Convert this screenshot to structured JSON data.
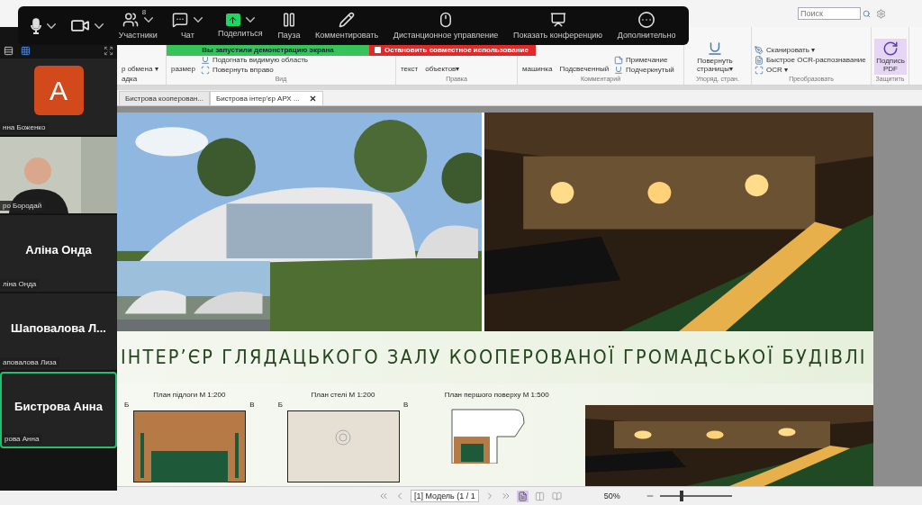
{
  "app_window": {
    "search": {
      "placeholder": "Поиск"
    }
  },
  "ribbon": {
    "groups": [
      {
        "items": [
          {
            "kind": "plain",
            "label": "р обмена ▾"
          },
          {
            "kind": "plain",
            "label": "адка"
          }
        ]
      },
      {
        "label": "Вид",
        "items": [
          {
            "kind": "text",
            "label": "размер"
          },
          {
            "kind": "small",
            "label": "Подогнать видимую область"
          },
          {
            "kind": "small",
            "label": "Повернуть вправо"
          }
        ]
      },
      {
        "label": "Правка",
        "items": [
          {
            "kind": "text",
            "label": "текст"
          },
          {
            "kind": "text",
            "label": "объектов▾"
          }
        ]
      },
      {
        "label": "Комментарий",
        "items": [
          {
            "kind": "text",
            "label": "машинка"
          },
          {
            "kind": "text",
            "label": "Подсвеченный"
          },
          {
            "kind": "small",
            "label": "Примечание"
          },
          {
            "kind": "small",
            "label": "Подчеркнутый"
          }
        ]
      },
      {
        "label": "Упоряд. стран.",
        "items": [
          {
            "kind": "large",
            "label": "Повернуть страницы▾"
          }
        ]
      },
      {
        "label": "Преобразовать",
        "items": [
          {
            "kind": "small",
            "label": "Сканировать ▾"
          },
          {
            "kind": "small",
            "label": "Быстрое OCR-распознавание"
          },
          {
            "kind": "small",
            "label": "OCR ▾"
          }
        ]
      },
      {
        "label": "Защитить",
        "items": [
          {
            "kind": "accent",
            "label": "Подпись PDF"
          }
        ]
      }
    ]
  },
  "share_banner": {
    "notice": "Вы запустили демонстрацию экрана",
    "stop_button": "Остановить совместное использование"
  },
  "meeting_toolbar": {
    "items": [
      {
        "kind": "mic",
        "caret": true
      },
      {
        "kind": "video",
        "caret": true
      },
      {
        "kind": "participants",
        "label": "Участники",
        "count": "8",
        "caret": true
      },
      {
        "kind": "chat",
        "label": "Чат",
        "caret": true
      },
      {
        "kind": "share",
        "label": "Поделиться",
        "caret": true
      },
      {
        "kind": "pause",
        "label": "Пауза",
        "caret": false
      },
      {
        "kind": "annotate",
        "label": "Комментировать",
        "caret": false
      },
      {
        "kind": "remote",
        "label": "Дистанционное управление",
        "caret": false
      },
      {
        "kind": "view",
        "label": "Показать конференцию",
        "caret": false
      },
      {
        "kind": "more",
        "label": "Дополнительно",
        "caret": false
      }
    ]
  },
  "participants_panel": {
    "tiles": [
      {
        "kind": "avatar",
        "initial": "A",
        "name_tag": "нна Боженко",
        "active": false
      },
      {
        "kind": "video",
        "name_tag": "ро Бородай",
        "active": false
      },
      {
        "kind": "name",
        "display_name": "Аліна Онда",
        "name_tag": "ліна Онда",
        "active": false
      },
      {
        "kind": "name",
        "display_name": "Шаповалова  Л...",
        "name_tag": "аповалова Лиза",
        "active": false
      },
      {
        "kind": "name",
        "display_name": "Бистрова Анна",
        "name_tag": "рова Анна",
        "active": true
      }
    ]
  },
  "document_tabs": [
    {
      "label": "Бистрова кооперован...",
      "selected": false
    },
    {
      "label": "Бистрова інтер'єр АРХ ...",
      "selected": true
    }
  ],
  "poster": {
    "title": "ІНТЕР’ЄР ГЛЯДАЦЬКОГО ЗАЛУ КООПЕРОВАНОЇ ГРОМАДСЬКОЇ БУДІВЛІ",
    "plans": [
      {
        "kind": "floor",
        "caption": "План підлоги М 1:200",
        "left_mark": "Б",
        "right_mark": "В"
      },
      {
        "kind": "ceiling",
        "caption": "План стелі М 1:200",
        "left_mark": "Б",
        "right_mark": "В"
      },
      {
        "kind": "site",
        "caption": "План першого поверху М 1:500"
      }
    ]
  },
  "status_bar": {
    "page_selector": "[1] Модель (1 / 1",
    "zoom": "50%",
    "zoom_slider": {
      "level": 0.3
    }
  }
}
